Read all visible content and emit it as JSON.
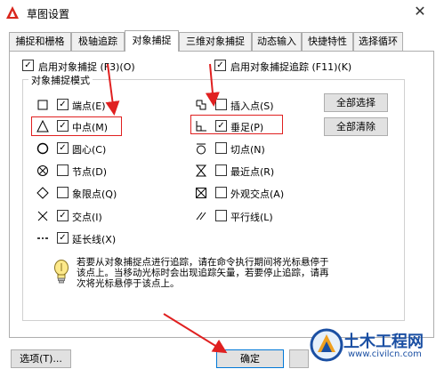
{
  "window": {
    "title": "草图设置",
    "close_glyph": "✕"
  },
  "tabs": [
    {
      "label": "捕捉和栅格",
      "active": false
    },
    {
      "label": "极轴追踪",
      "active": false
    },
    {
      "label": "对象捕捉",
      "active": true
    },
    {
      "label": "三维对象捕捉",
      "active": false
    },
    {
      "label": "动态输入",
      "active": false
    },
    {
      "label": "快捷特性",
      "active": false
    },
    {
      "label": "选择循环",
      "active": false
    }
  ],
  "enable_snap": {
    "label": "启用对象捕捉 (F3)(O)",
    "checked": true
  },
  "enable_tracking": {
    "label": "启用对象捕捉追踪 (F11)(K)",
    "checked": true
  },
  "modes_group": {
    "title": "对象捕捉模式"
  },
  "modes_left": [
    {
      "symbol": "square-icon",
      "label": "端点(E)",
      "checked": true
    },
    {
      "symbol": "triangle-icon",
      "label": "中点(M)",
      "checked": true
    },
    {
      "symbol": "circle-center-icon",
      "label": "圆心(C)",
      "checked": true
    },
    {
      "symbol": "circle-x-icon",
      "label": "节点(D)",
      "checked": false
    },
    {
      "symbol": "diamond-icon",
      "label": "象限点(Q)",
      "checked": false
    },
    {
      "symbol": "x-icon",
      "label": "交点(I)",
      "checked": true
    },
    {
      "symbol": "extension-icon",
      "label": "延长线(X)",
      "checked": true
    }
  ],
  "modes_right": [
    {
      "symbol": "insert-icon",
      "label": "插入点(S)",
      "checked": false
    },
    {
      "symbol": "perpendicular-icon",
      "label": "垂足(P)",
      "checked": true
    },
    {
      "symbol": "tangent-icon",
      "label": "切点(N)",
      "checked": false
    },
    {
      "symbol": "hourglass-icon",
      "label": "最近点(R)",
      "checked": false
    },
    {
      "symbol": "box-x-icon",
      "label": "外观交点(A)",
      "checked": false
    },
    {
      "symbol": "parallel-icon",
      "label": "平行线(L)",
      "checked": false
    }
  ],
  "buttons": {
    "select_all": "全部选择",
    "clear_all": "全部清除",
    "options": "选项(T)...",
    "ok": "确定"
  },
  "info": {
    "line1": "若要从对象捕捉点进行追踪，请在命令执行期间将光标悬停于",
    "line2": "该点上。当移动光标时会出现追踪矢量，若要停止追踪，请再",
    "line3": "次将光标悬停于该点上。"
  },
  "watermark": {
    "title": "土木工程网",
    "url": "www.civilcn.com"
  },
  "colors": {
    "annotation": "#e02020",
    "watermark": "#1a4fa3",
    "focus": "#0078d7"
  }
}
